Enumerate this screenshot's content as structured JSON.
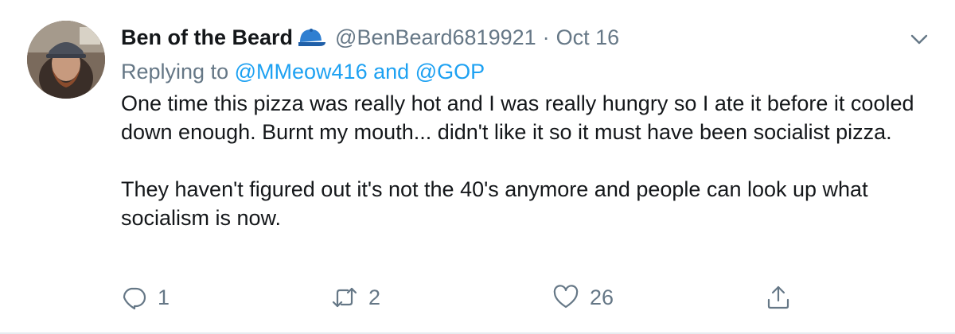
{
  "tweet": {
    "display_name": "Ben of the Beard",
    "handle": "@BenBeard6819921",
    "separator": "·",
    "date": "Oct 16",
    "replying_prefix": "Replying to",
    "replying_mention_1": "@MMeow416",
    "replying_conjunction": "and",
    "replying_mention_2": "@GOP",
    "paragraph_1": "One time this pizza was really hot and I was really hungry so I ate it before it cooled down enough. Burnt my mouth... didn't like it so it must have been socialist pizza.",
    "paragraph_2": "They haven't figured out it's not the 40's anymore and people can look up what socialism is now.",
    "reply_count": "1",
    "retweet_count": "2",
    "like_count": "26"
  },
  "colors": {
    "text_primary": "#14171a",
    "text_secondary": "#657786",
    "accent": "#1da1f2",
    "border": "#e6ecf0"
  },
  "icons": {
    "badge": "blue-cap-icon",
    "caret": "chevron-down-icon",
    "reply": "reply-icon",
    "retweet": "retweet-icon",
    "like": "heart-icon",
    "share": "share-icon"
  }
}
